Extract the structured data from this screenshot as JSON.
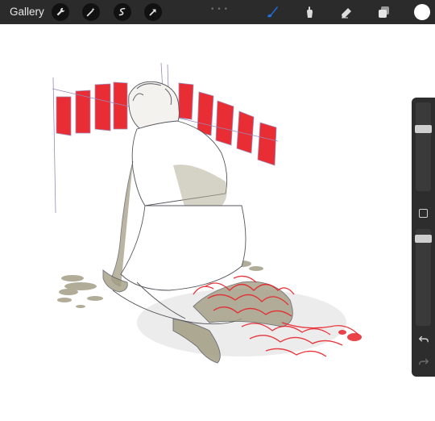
{
  "topbar": {
    "gallery_label": "Gallery",
    "left_tools": [
      "wrench-icon",
      "magic-wand-icon",
      "selection-icon",
      "transform-arrow-icon"
    ],
    "right_tools": [
      "brush-icon",
      "smudge-icon",
      "eraser-icon",
      "layers-icon"
    ],
    "active_tool": "brush-icon",
    "active_color": "#1f6fe0",
    "current_color": "#ffffff"
  },
  "sidebar": {
    "brush_size_level": 0.2,
    "opacity_level": 0.05
  },
  "canvas": {
    "accent_red": "#e8222a",
    "skin_tone": "#a29d83"
  }
}
